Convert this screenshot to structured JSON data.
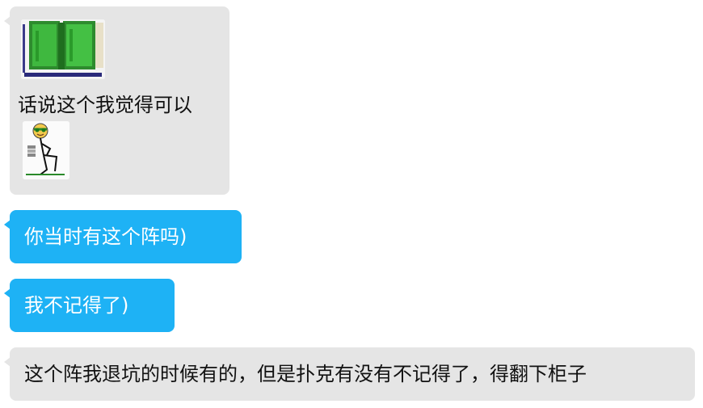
{
  "messages": [
    {
      "id": "msg1",
      "side": "incoming",
      "color": "#e5e5e5",
      "image": "card-screenshot-image",
      "text": "话说这个我觉得可以",
      "sticker": "stick-figure-sticker"
    },
    {
      "id": "msg2",
      "side": "outgoing",
      "color": "#1eb2f5",
      "text": "你当时有这个阵吗)"
    },
    {
      "id": "msg3",
      "side": "outgoing",
      "color": "#1eb2f5",
      "text": "我不记得了)"
    },
    {
      "id": "msg4",
      "side": "incoming",
      "color": "#e5e5e5",
      "text": "这个阵我退坑的时候有的，但是扑克有没有不记得了，得翻下柜子"
    }
  ]
}
